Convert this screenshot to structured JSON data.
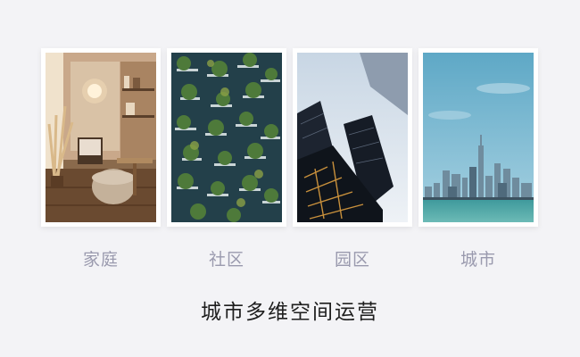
{
  "cards": [
    {
      "label": "家庭",
      "image": "home-interior-photo"
    },
    {
      "label": "社区",
      "image": "community-green-building-photo"
    },
    {
      "label": "园区",
      "image": "park-office-towers-photo"
    },
    {
      "label": "城市",
      "image": "city-skyline-photo"
    }
  ],
  "title": "城市多维空间运营",
  "colors": {
    "background": "#f3f3f6",
    "label": "#9a9aae",
    "title": "#1e1e1e"
  }
}
